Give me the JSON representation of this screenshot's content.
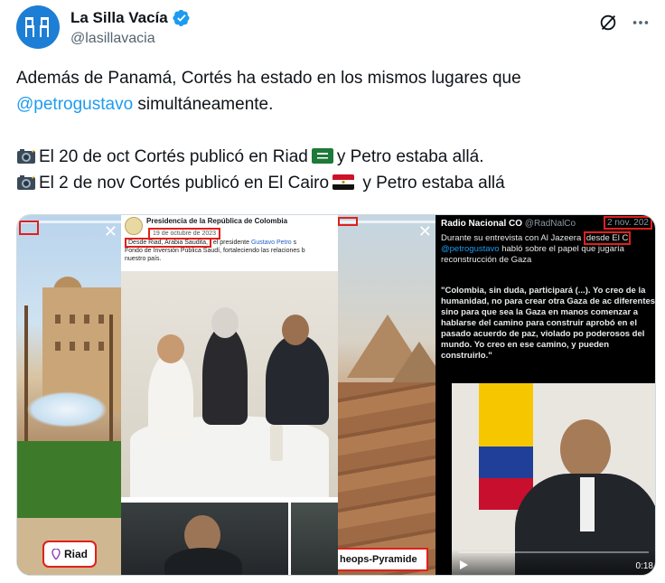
{
  "author": {
    "display_name": "La Silla Vacía",
    "handle": "@lasillavacia"
  },
  "tweet": {
    "line1": "Además de Panamá, Cortés ha estado en los mismos lugares que",
    "mention": "@petrogustavo",
    "line2_rest": " simultáneamente.",
    "line3_a": "El 20 de oct Cortés publicó en Riad",
    "line3_b": "y Petro estaba allá.",
    "line4_a": "El 2 de nov Cortés publicó en El Cairo",
    "line4_b": " y  Petro estaba allá"
  },
  "media": {
    "panel1": {
      "location_label": "Riad"
    },
    "panel2": {
      "account_name": "Presidencia de la República de Colombia",
      "date": "19 de octubre de 2023",
      "highlight": "Desde Riad, Arabia Saudita,",
      "text_a": " el presidente ",
      "mention": "Gustavo Petro",
      "text_b": " s",
      "line2": "Fondo de Inversión Pública Saudí,  fortaleciendo las relaciones b",
      "line3": "nuestro país."
    },
    "panel3": {
      "location_label": "heops-Pyramide"
    },
    "panel4": {
      "account_name": "Radio Nacional CO",
      "account_handle": "@RadNalCo",
      "date": "2 nov. 202",
      "text_a": "Durante su entrevista con Al Jazeera ",
      "highlight": "desde El C",
      "mention": "@petrogustavo",
      "text_b": " habló sobre el papel que jugaría",
      "text_c": "reconstrucción de Gaza",
      "quote": "\"Colombia, sin duda, participará (...). Yo creo de la humanidad, no para crear otra Gaza de ac diferentes, sino para que sea la Gaza en manos comenzar a hablarse del camino para construir aprobó en el pasado acuerdo de paz, violado po poderosos del mundo. Yo creo en ese camino, y pueden construirlo.\"",
      "video_time": "0:18"
    }
  },
  "colors": {
    "accent": "#1d9bf0",
    "highlight_box": "#e0201b",
    "text": "#0f1419",
    "secondary_text": "#536471"
  }
}
